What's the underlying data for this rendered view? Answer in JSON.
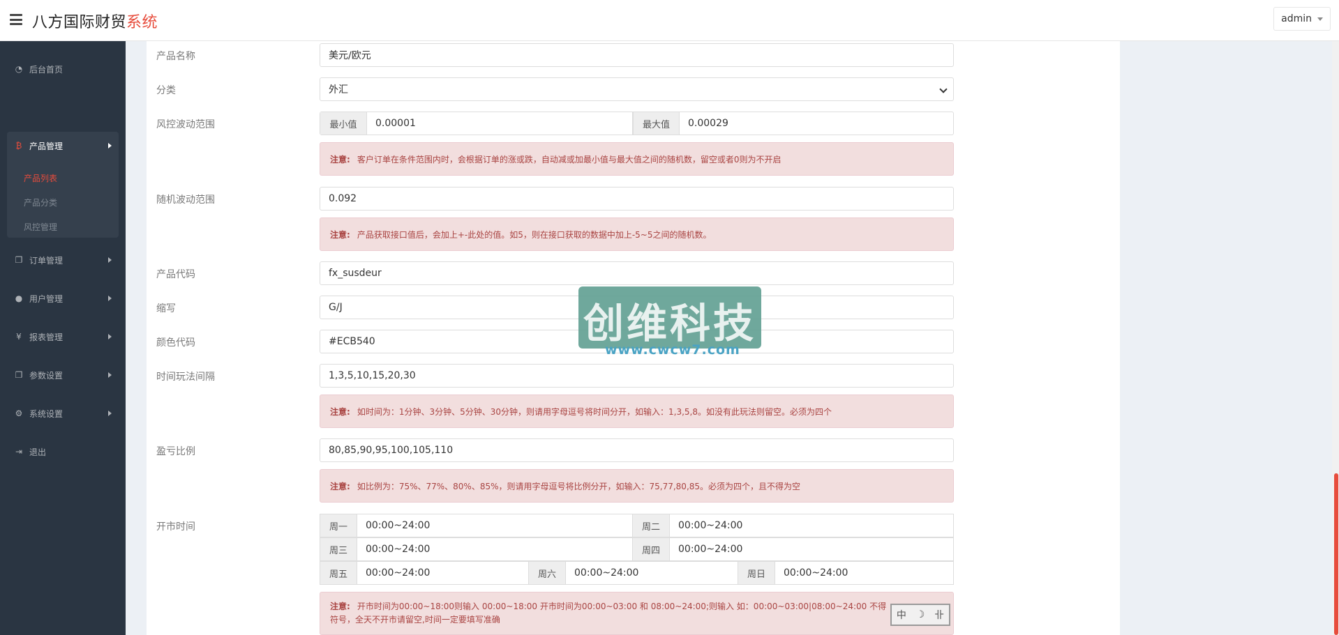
{
  "header": {
    "brand_main": "八方国际财贸",
    "brand_accent": "系统",
    "user": "admin"
  },
  "sidebar": {
    "home": "后台首页",
    "product_mgmt": "产品管理",
    "sub": [
      "产品列表",
      "产品分类",
      "风控管理"
    ],
    "order_mgmt": "订单管理",
    "user_mgmt": "用户管理",
    "report_mgmt": "报表管理",
    "param_settings": "参数设置",
    "system_settings": "系统设置",
    "logout": "退出"
  },
  "form": {
    "name_label": "产品名称",
    "name_value": "美元/欧元",
    "category_label": "分类",
    "category_value": "外汇",
    "risk_label": "风控波动范围",
    "risk_min_label": "最小值",
    "risk_min_value": "0.00001",
    "risk_max_label": "最大值",
    "risk_max_value": "0.00029",
    "risk_note_prefix": "注意:",
    "risk_note": "客户订单在条件范围内时，会根据订单的涨或跌，自动减或加最小值与最大值之间的随机数，留空或者0则为不开启",
    "random_label": "随机波动范围",
    "random_value": "0.092",
    "random_note_prefix": "注意:",
    "random_note": "产品获取接口值后，会加上+-此处的值。如5，则在接口获取的数据中加上-5~5之间的随机数。",
    "code_label": "产品代码",
    "code_value": "fx_susdeur",
    "abbr_label": "缩写",
    "abbr_value": "G/J",
    "color_label": "颜色代码",
    "color_value": "#ECB540",
    "interval_label": "时间玩法间隔",
    "interval_value": "1,3,5,10,15,20,30",
    "interval_note_prefix": "注意:",
    "interval_note": "如时间为：1分钟、3分钟、5分钟、30分钟，则请用字母逗号将时间分开，如输入：1,3,5,8。如没有此玩法则留空。必须为四个",
    "ratio_label": "盈亏比例",
    "ratio_value": "80,85,90,95,100,105,110",
    "ratio_note_prefix": "注意:",
    "ratio_note": "如比例为：75%、77%、80%、85%，则请用字母逗号将比例分开，如输入：75,77,80,85。必须为四个，且不得为空",
    "market_label": "开市时间",
    "days": [
      {
        "label": "周一",
        "value": "00:00~24:00"
      },
      {
        "label": "周二",
        "value": "00:00~24:00"
      },
      {
        "label": "周三",
        "value": "00:00~24:00"
      },
      {
        "label": "周四",
        "value": "00:00~24:00"
      },
      {
        "label": "周五",
        "value": "00:00~24:00"
      },
      {
        "label": "周六",
        "value": "00:00~24:00"
      },
      {
        "label": "周日",
        "value": "00:00~24:00"
      }
    ],
    "market_note_prefix": "注意:",
    "market_note_line1": "开市时间为00:00~18:00则输入 00:00~18:00 开市时间为00:00~03:00 和 08:00~24:00;则输入 如：00:00~03:00|08:00~24:00 不得",
    "market_note_line2": "符号，全天不开市请留空,时间一定要填写准确"
  },
  "watermark": {
    "text": "创维科技",
    "url": "www.cwcw7.com"
  },
  "ime": {
    "chars": [
      "中",
      "☽",
      "卝"
    ]
  },
  "colors": {
    "accent": "#e74c3c",
    "sidebar_bg": "#2a3542",
    "alert_bg": "#f2dede",
    "alert_text": "#a94442"
  }
}
